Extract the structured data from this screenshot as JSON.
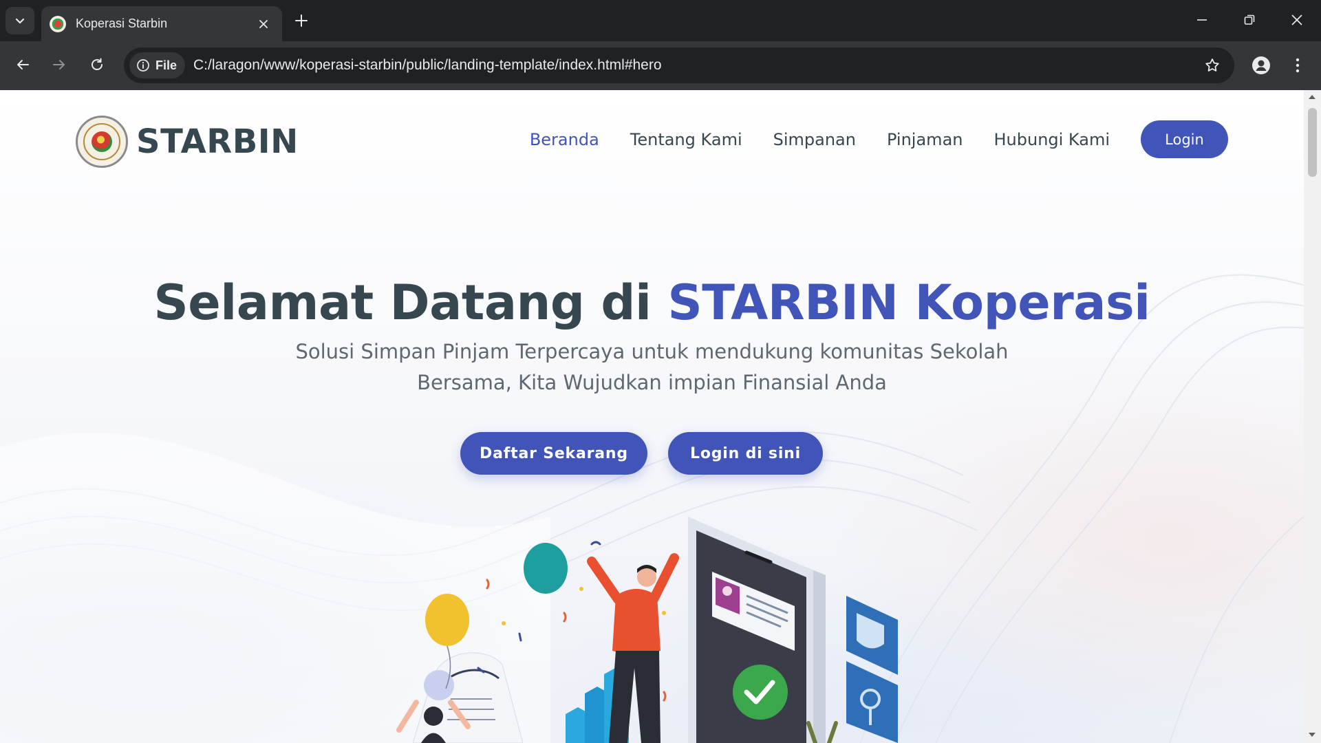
{
  "browser": {
    "tab_title": "Koperasi Starbin",
    "site_chip_label": "File",
    "url": "C:/laragon/www/koperasi-starbin/public/landing-template/index.html#hero"
  },
  "header": {
    "brand": "STARBIN",
    "nav": [
      "Beranda",
      "Tentang Kami",
      "Simpanan",
      "Pinjaman",
      "Hubungi Kami"
    ],
    "active_nav": "Beranda",
    "login_label": "Login"
  },
  "hero": {
    "title_part1": "Selamat Datang di ",
    "title_accent": "STARBIN Koperasi",
    "subtitle_line1": "Solusi Simpan Pinjam Terpercaya untuk mendukung komunitas Sekolah",
    "subtitle_line2": "Bersama, Kita Wujudkan impian Finansial Anda",
    "cta_primary": "Daftar Sekarang",
    "cta_secondary": "Login di sini"
  },
  "colors": {
    "brand_blue": "#4154b8",
    "heading_dark": "#37474f",
    "chrome_dark": "#202124",
    "chrome_toolbar": "#35363a"
  },
  "icons": {
    "tab_search": "chevron-down-icon",
    "tab_close": "close-icon",
    "new_tab": "plus-icon",
    "back": "arrow-left-icon",
    "forward": "arrow-right-icon",
    "reload": "reload-icon",
    "site_info": "info-icon",
    "bookmark": "star-icon",
    "profile": "account-icon",
    "menu": "kebab-menu-icon"
  }
}
